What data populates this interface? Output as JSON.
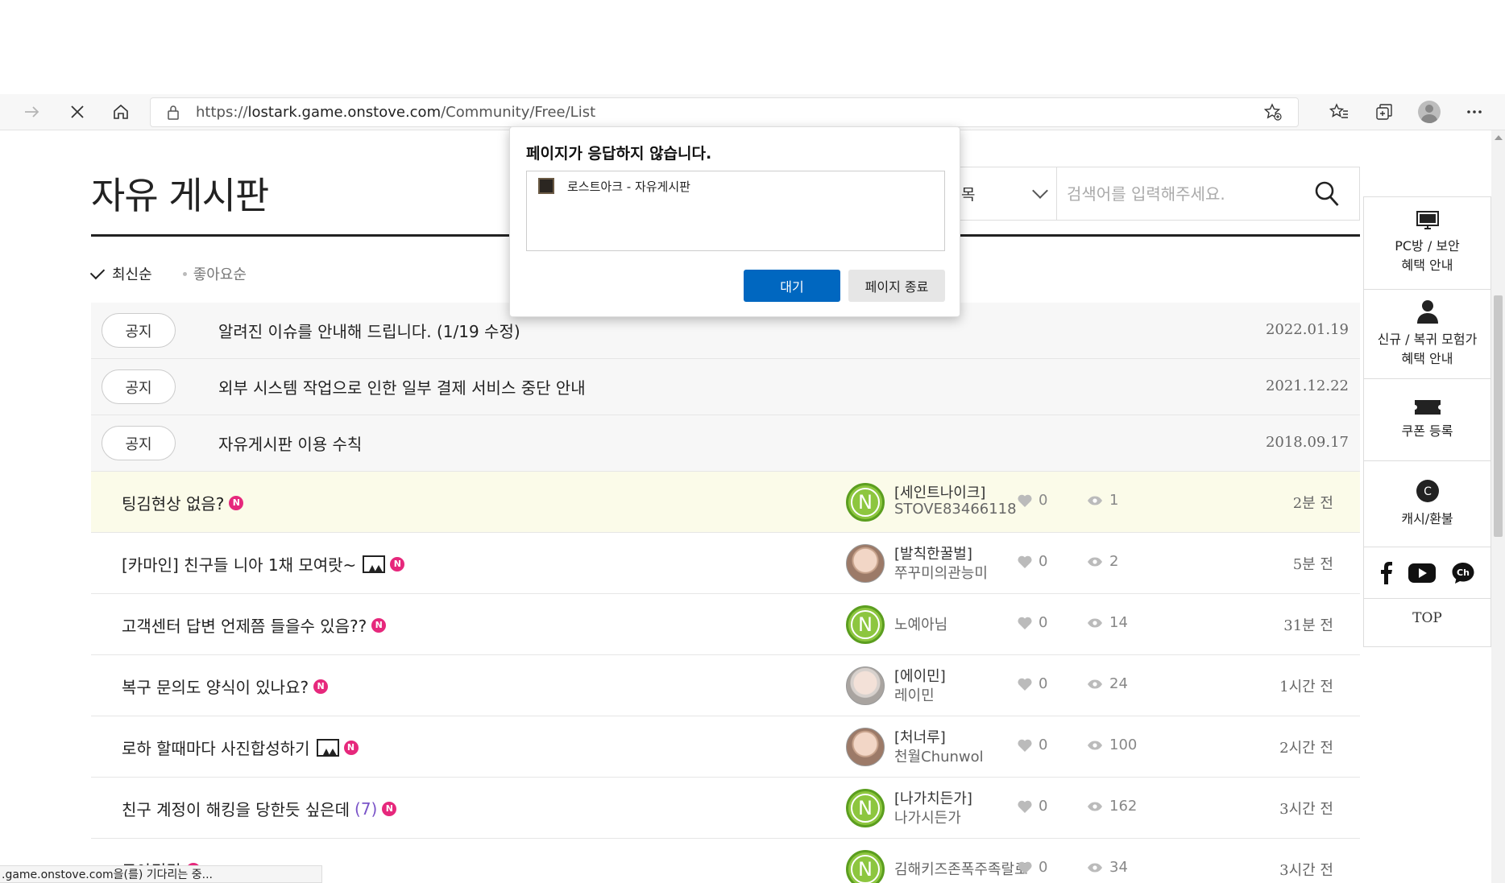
{
  "browser": {
    "url_scheme": "https://",
    "url_host": "lostark.game.onstove.com",
    "url_path": "/Community/Free/List"
  },
  "board": {
    "title": "자유 게시판",
    "search_select": "목",
    "search_placeholder": "검색어를 입력해주세요."
  },
  "sort": {
    "active": "최신순",
    "inactive": "좋아요순"
  },
  "notices": [
    {
      "badge": "공지",
      "title": "알려진 이슈를 안내해 드립니다. (1/19 수정)",
      "date": "2022.01.19"
    },
    {
      "badge": "공지",
      "title": "외부 시스템 작업으로 인한 일부 결제 서비스 중단 안내",
      "date": "2021.12.22"
    },
    {
      "badge": "공지",
      "title": "자유게시판 이용 수칙",
      "date": "2018.09.17"
    }
  ],
  "posts": [
    {
      "title": "팅김현상 없음?",
      "comments": "",
      "guild": "[세인트나이크]",
      "nick": "STOVE83466118",
      "likes": "0",
      "views": "1",
      "time": "2분 전",
      "avatar": "N"
    },
    {
      "title": "[카마인] 친구들 니아 1채 모여랏~",
      "comments": "",
      "guild": "[발칙한꿀벌]",
      "nick": "쭈꾸미의관능미",
      "likes": "0",
      "views": "2",
      "time": "5분 전",
      "avatar": "face"
    },
    {
      "title": "고객센터 답변 언제쯤 들을수 있음??",
      "comments": "",
      "guild": "",
      "nick": "노예아님",
      "likes": "0",
      "views": "14",
      "time": "31분 전",
      "avatar": "N"
    },
    {
      "title": "복구 문의도 양식이 있나요?",
      "comments": "",
      "guild": "[에이민]",
      "nick": "레이민",
      "likes": "0",
      "views": "24",
      "time": "1시간 전",
      "avatar": "face2"
    },
    {
      "title": "로하 할때마다 사진합성하기",
      "comments": "",
      "guild": "[처너루]",
      "nick": "천월Chunwol",
      "likes": "0",
      "views": "100",
      "time": "2시간 전",
      "avatar": "face"
    },
    {
      "title": "친구 계정이 해킹을 당한듯 싶은데",
      "comments": "(7)",
      "guild": "[나가치든가]",
      "nick": "나가시든가",
      "likes": "0",
      "views": "162",
      "time": "3시간 전",
      "avatar": "N"
    },
    {
      "title": "로아팅김",
      "comments": "",
      "guild": "",
      "nick": "김해키즈존폭주족랄로",
      "likes": "0",
      "views": "34",
      "time": "3시간 전",
      "avatar": "N"
    }
  ],
  "quick_menu": {
    "pc": "PC방 / 보안\n혜택 안내",
    "newbie": "신규 / 복귀 모험가\n혜택 안내",
    "coupon": "쿠폰 등록",
    "cash": "캐시/환불",
    "top": "TOP"
  },
  "dialog": {
    "title": "페이지가 응답하지 않습니다.",
    "tab_name": "로스트아크 - 자유게시판",
    "wait": "대기",
    "close": "페이지 종료"
  },
  "status": ".game.onstove.com을(를) 기다리는 중..."
}
